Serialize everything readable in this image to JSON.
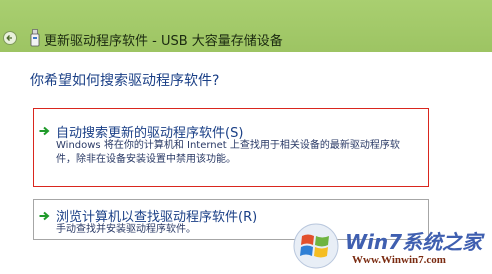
{
  "window": {
    "title": "更新驱动程序软件 - USB 大容量存储设备",
    "accent_color": "#a9cf70"
  },
  "question": "你希望如何搜索驱动程序软件?",
  "options": [
    {
      "title": "自动搜索更新的驱动程序软件(S)",
      "description": "Windows 将在你的计算机和 Internet 上查找用于相关设备的最新驱动程序软件，除非在设备安装设置中禁用该功能。",
      "icon": "green-arrow-icon",
      "highlight_color": "#d9261e"
    },
    {
      "title": "浏览计算机以查找驱动程序软件(R)",
      "description": "手动查找并安装驱动程序软件。",
      "icon": "green-arrow-icon"
    }
  ],
  "watermark": {
    "brand": "Win7系统之家",
    "url": "Www.Winwin7.com"
  }
}
